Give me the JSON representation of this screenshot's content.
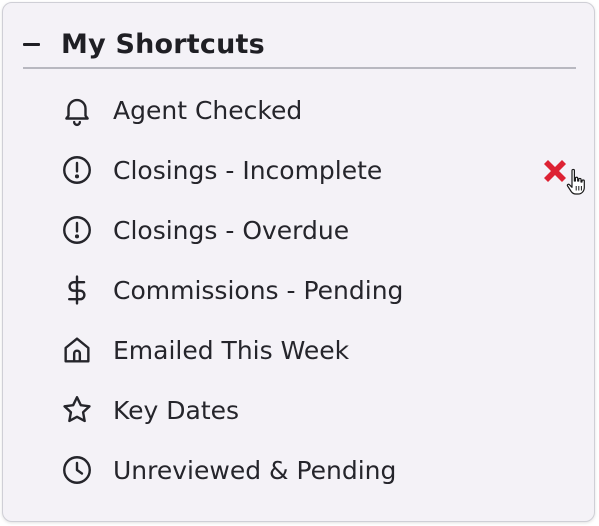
{
  "panel": {
    "collapse_icon": "minus-icon",
    "title": "My Shortcuts"
  },
  "shortcuts": [
    {
      "label": "Agent Checked",
      "icon": "bell-icon"
    },
    {
      "label": "Closings - Incomplete",
      "icon": "alert-circle-icon",
      "hovered": true
    },
    {
      "label": "Closings - Overdue",
      "icon": "alert-circle-icon"
    },
    {
      "label": "Commissions - Pending",
      "icon": "dollar-icon"
    },
    {
      "label": "Emailed This Week",
      "icon": "home-icon"
    },
    {
      "label": "Key Dates",
      "icon": "star-icon"
    },
    {
      "label": "Unreviewed & Pending",
      "icon": "clock-icon"
    }
  ],
  "colors": {
    "remove": "#dd2233",
    "text": "#25252b",
    "panel_bg": "#f4f2f7"
  }
}
